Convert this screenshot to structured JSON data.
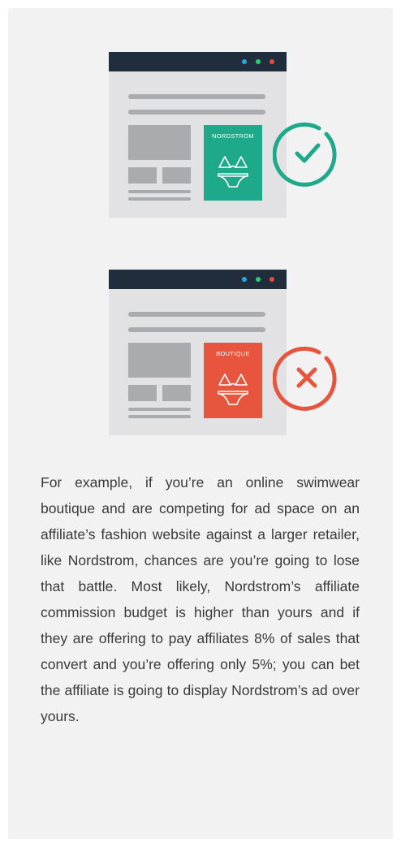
{
  "illustration_good": {
    "ad_label": "NORDSTROM",
    "ad_color": "#1eaa8a",
    "status_icon": "check-circle-icon",
    "status_color": "#1eaa8a"
  },
  "illustration_bad": {
    "ad_label": "BOUTIQUE",
    "ad_color": "#e8553f",
    "status_icon": "x-circle-icon",
    "status_color": "#e8553f"
  },
  "window_dot_colors": [
    "#2aa8e0",
    "#2ecc71",
    "#e74c3c"
  ],
  "body_text": "For example, if you’re an online swimwear boutique and are competing for ad space on an affiliate’s fashion website against a larger retailer, like Nordstrom, chances are you’re going to lose that battle. Most likely, Nordstrom’s affiliate commission budget is higher than yours and if they are offering to pay affiliates 8% of sales that convert and you’re offering only 5%; you can bet the affiliate is going to display Nordstrom’s ad over yours."
}
